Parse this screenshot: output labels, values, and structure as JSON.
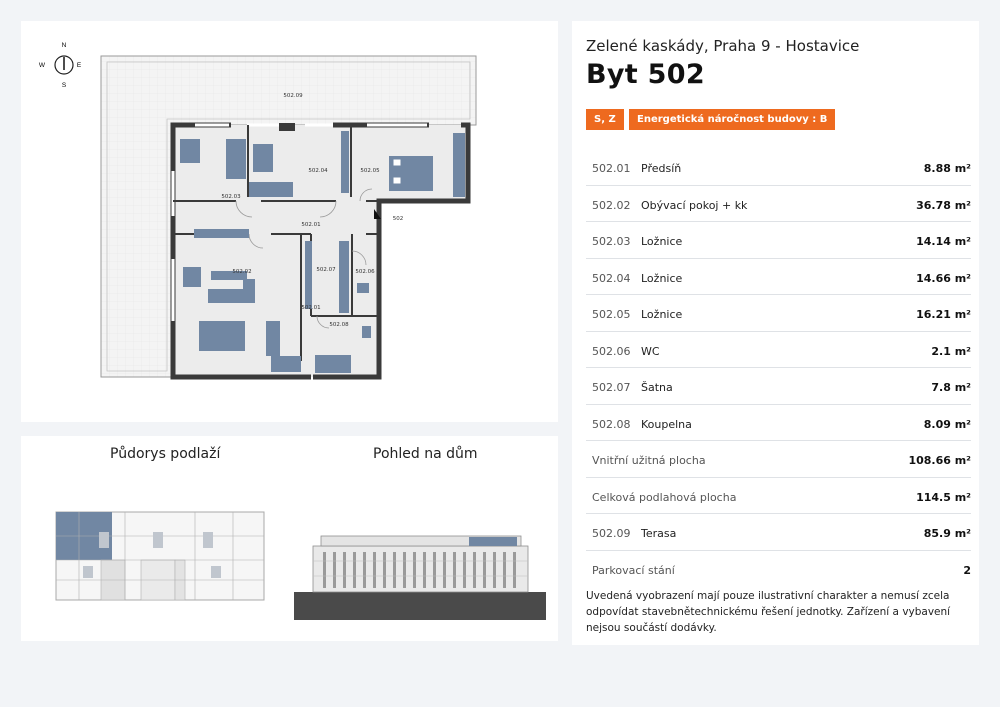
{
  "project": "Zelené kaskády, Praha 9 - Hostavice",
  "apartment": "Byt 502",
  "orientation_badge": "S, Z",
  "energy_badge": "Energetická náročnost budovy : B",
  "accent_color": "#ee6a1f",
  "room_color": "#7187a3",
  "rooms": [
    {
      "code": "502.01",
      "name": "Předsíň",
      "area": "8.88 m²"
    },
    {
      "code": "502.02",
      "name": "Obývací pokoj + kk",
      "area": "36.78 m²"
    },
    {
      "code": "502.03",
      "name": "Ložnice",
      "area": "14.14 m²"
    },
    {
      "code": "502.04",
      "name": "Ložnice",
      "area": "14.66 m²"
    },
    {
      "code": "502.05",
      "name": "Ložnice",
      "area": "16.21 m²"
    },
    {
      "code": "502.06",
      "name": "WC",
      "area": "2.1 m²"
    },
    {
      "code": "502.07",
      "name": "Šatna",
      "area": "7.8 m²"
    },
    {
      "code": "502.08",
      "name": "Koupelna",
      "area": "8.09 m²"
    }
  ],
  "interior_area": {
    "label": "Vnitřní užitná plocha",
    "value": "108.66 m²"
  },
  "total_floor_area": {
    "label": "Celková podlahová plocha",
    "value": "114.5 m²"
  },
  "terrace": {
    "code": "502.09",
    "name": "Terasa",
    "area": "85.9 m²"
  },
  "parking": {
    "label": "Parkovací stání",
    "value": "2"
  },
  "note": "Uvedená vyobrazení mají pouze ilustrativní charakter a nemusí zcela odpovídat stavebnětechnickému řešení jednotky. Zařízení a vybavení nejsou součástí dodávky.",
  "floorplan": {
    "compass": {
      "n": "N",
      "e": "E",
      "s": "S",
      "w": "W"
    },
    "labels": {
      "terrace": "502.09",
      "r01": "502.01",
      "r02": "502.02",
      "r03": "502.03",
      "r04": "502.04",
      "r05": "502.05",
      "r06": "502.06",
      "r07": "502.07",
      "r08": "502.08",
      "entrance": "502"
    }
  },
  "overview": {
    "floor_title": "Půdorys podlaží",
    "house_title": "Pohled na dům"
  }
}
